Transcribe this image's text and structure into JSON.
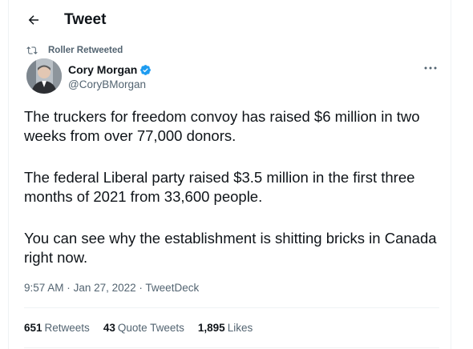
{
  "header": {
    "title": "Tweet",
    "back_icon": "arrow-left-icon"
  },
  "retweet": {
    "label": "Roller Retweeted",
    "icon": "retweet-icon"
  },
  "author": {
    "name": "Cory Morgan",
    "handle": "@CoryBMorgan",
    "verified_color": "#1d9bf0"
  },
  "tweet": {
    "paragraphs": [
      "The truckers for freedom convoy has raised $6 million in two weeks from over 77,000 donors.",
      "The federal Liberal party raised $3.5 million in the first three months of 2021 from 33,600 people.",
      "You can see why the establishment is shitting bricks in Canada right now."
    ],
    "time": "9:57 AM",
    "date": "Jan 27, 2022",
    "source": "TweetDeck",
    "sep": "·"
  },
  "stats": {
    "retweets_count": "651",
    "retweets_label": "Retweets",
    "quotes_count": "43",
    "quotes_label": "Quote Tweets",
    "likes_count": "1,895",
    "likes_label": "Likes"
  }
}
